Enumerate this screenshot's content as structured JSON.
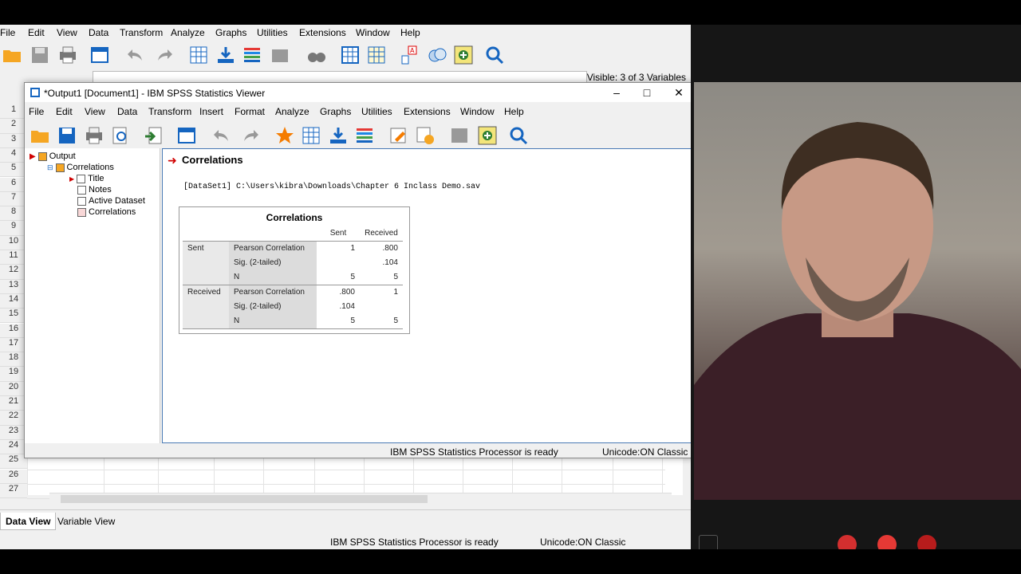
{
  "editor": {
    "menu": [
      "File",
      "Edit",
      "View",
      "Data",
      "Transform",
      "Analyze",
      "Graphs",
      "Utilities",
      "Extensions",
      "Window",
      "Help"
    ],
    "visible_vars": "Visible: 3 of 3 Variables",
    "row_numbers": [
      "1",
      "2",
      "3",
      "4",
      "5",
      "6",
      "7",
      "8",
      "9",
      "10",
      "11",
      "12",
      "13",
      "14",
      "15",
      "16",
      "17",
      "18",
      "19",
      "20",
      "21",
      "22",
      "23",
      "24",
      "25",
      "26",
      "27"
    ],
    "tabs": {
      "data_view": "Data View",
      "variable_view": "Variable View"
    },
    "status": {
      "processor": "IBM SPSS Statistics Processor is ready",
      "unicode": "Unicode:ON Classic"
    }
  },
  "viewer": {
    "title": "*Output1 [Document1] - IBM SPSS Statistics Viewer",
    "menu": [
      "File",
      "Edit",
      "View",
      "Data",
      "Transform",
      "Insert",
      "Format",
      "Analyze",
      "Graphs",
      "Utilities",
      "Extensions",
      "Window",
      "Help"
    ],
    "nav": {
      "output": "Output",
      "correlations": "Correlations",
      "title": "Title",
      "notes": "Notes",
      "active_dataset": "Active Dataset",
      "correlations_table": "Correlations"
    },
    "content": {
      "heading": "Correlations",
      "dataset_line": "[DataSet1] C:\\Users\\kibra\\Downloads\\Chapter 6 Inclass Demo.sav",
      "table": {
        "title": "Correlations",
        "columns": [
          "Sent",
          "Received"
        ],
        "rows": [
          {
            "var": "Sent",
            "stat": "Pearson Correlation",
            "values": [
              "1",
              ".800"
            ]
          },
          {
            "var": "",
            "stat": "Sig. (2-tailed)",
            "values": [
              "",
              ".104"
            ]
          },
          {
            "var": "",
            "stat": "N",
            "values": [
              "5",
              "5"
            ]
          },
          {
            "var": "Received",
            "stat": "Pearson Correlation",
            "values": [
              ".800",
              "1"
            ]
          },
          {
            "var": "",
            "stat": "Sig. (2-tailed)",
            "values": [
              ".104",
              ""
            ]
          },
          {
            "var": "",
            "stat": "N",
            "values": [
              "5",
              "5"
            ]
          }
        ]
      }
    },
    "status": {
      "processor": "IBM SPSS Statistics Processor is ready",
      "unicode": "Unicode:ON Classic"
    }
  },
  "colors": {
    "accent_blue": "#1565c0",
    "arrow_red": "#d00000",
    "content_border": "#4a7ab5"
  }
}
